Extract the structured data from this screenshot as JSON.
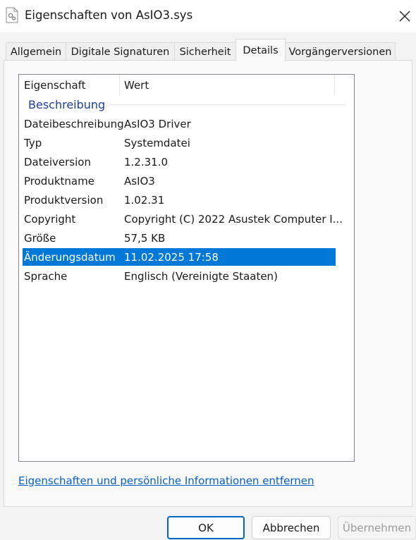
{
  "window": {
    "title": "Eigenschaften von AsIO3.sys",
    "file_icon": "system-file-icon",
    "close_icon": "close-icon"
  },
  "tabs": [
    {
      "label": "Allgemein",
      "active": false
    },
    {
      "label": "Digitale Signaturen",
      "active": false
    },
    {
      "label": "Sicherheit",
      "active": false
    },
    {
      "label": "Details",
      "active": true
    },
    {
      "label": "Vorgängerversionen",
      "active": false
    }
  ],
  "details": {
    "columns": {
      "property": "Eigenschaft",
      "value": "Wert"
    },
    "group": "Beschreibung",
    "rows": [
      {
        "key": "Dateibeschreibung",
        "value": "AsIO3 Driver"
      },
      {
        "key": "Typ",
        "value": "Systemdatei"
      },
      {
        "key": "Dateiversion",
        "value": "1.2.31.0"
      },
      {
        "key": "Produktname",
        "value": "AsIO3"
      },
      {
        "key": "Produktversion",
        "value": "1.02.31"
      },
      {
        "key": "Copyright",
        "value": "Copyright (C) 2022 Asustek Computer I..."
      },
      {
        "key": "Größe",
        "value": "57,5 KB"
      },
      {
        "key": "Änderungsdatum",
        "value": "11.02.2025 17:58",
        "selected": true
      },
      {
        "key": "Sprache",
        "value": "Englisch (Vereinigte Staaten)"
      }
    ]
  },
  "remove_link": "Eigenschaften und persönliche Informationen entfernen",
  "buttons": {
    "ok": "OK",
    "cancel": "Abbrechen",
    "apply": "Übernehmen"
  },
  "colors": {
    "selection": "#0078d7",
    "group_text": "#1e3e9e",
    "link": "#0a60c2",
    "ok_border": "#0067c0"
  }
}
